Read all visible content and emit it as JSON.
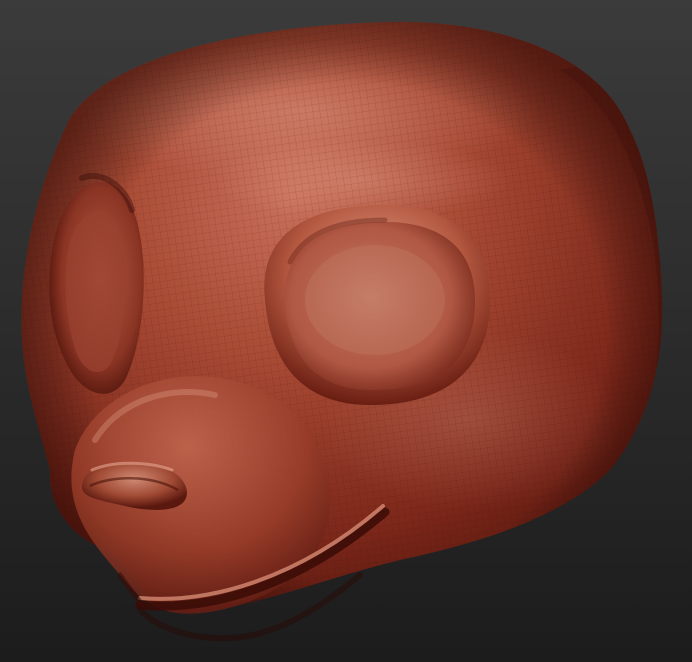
{
  "scene": {
    "subject": "sculpted-head",
    "material": "matcap-red-wax",
    "colors": {
      "background_top": "#3b3b3b",
      "background_bottom": "#1c1c1c",
      "clay_light": "#cf7a62",
      "clay_mid": "#a6452e",
      "clay_dark": "#5e1a10",
      "clay_shadow": "#3a0e08",
      "eye_socket": "#b75c46"
    },
    "wireframe_visible": true
  }
}
